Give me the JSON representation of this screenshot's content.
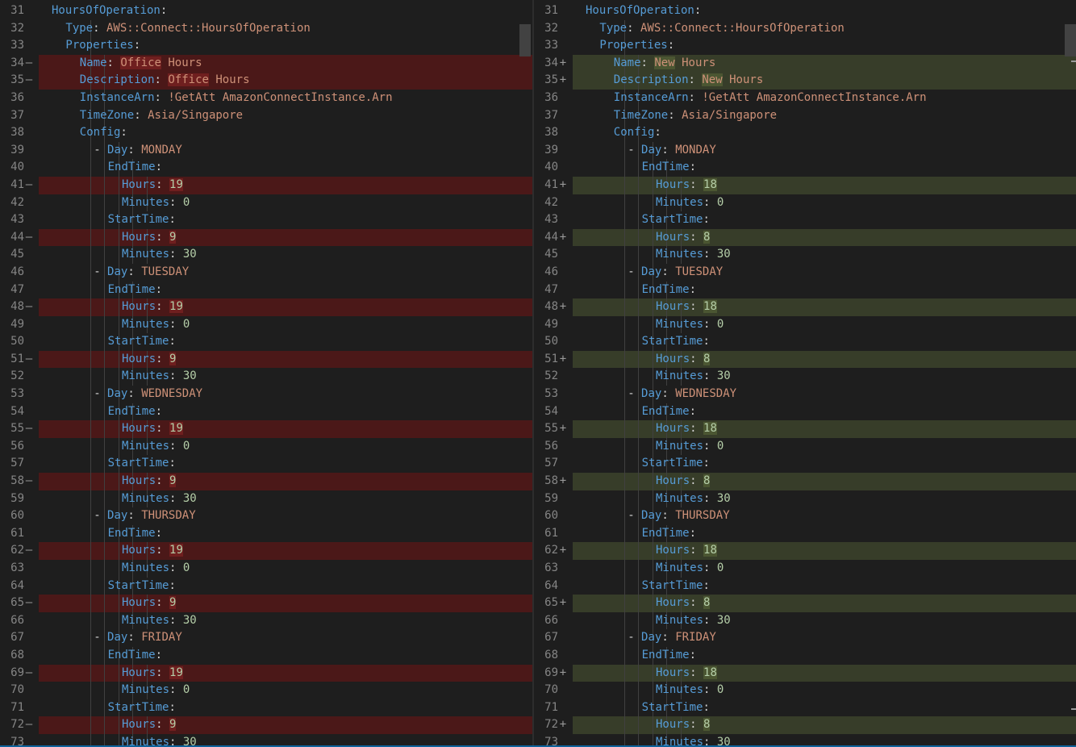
{
  "colors": {
    "background": "#1e1e1e",
    "key": "#569cd6",
    "string": "#ce9178",
    "number": "#b5cea8",
    "removed_line": "#4b1818",
    "added_line": "#373d29",
    "line_number": "#858585"
  },
  "left": {
    "lines": [
      {
        "num": "31",
        "mark": "",
        "type": "ctx",
        "indent": 0,
        "key": "HoursOfOperation",
        "value": "",
        "vtype": ""
      },
      {
        "num": "32",
        "mark": "",
        "type": "ctx",
        "indent": 1,
        "key": "Type",
        "value": "AWS::Connect::HoursOfOperation",
        "vtype": "s"
      },
      {
        "num": "33",
        "mark": "",
        "type": "ctx",
        "indent": 1,
        "key": "Properties",
        "value": "",
        "vtype": ""
      },
      {
        "num": "34",
        "mark": "—",
        "type": "del",
        "indent": 2,
        "key": "Name",
        "word": "Office",
        "value": " Hours",
        "vtype": "s"
      },
      {
        "num": "35",
        "mark": "—",
        "type": "del",
        "indent": 2,
        "key": "Description",
        "word": "Office",
        "value": " Hours",
        "vtype": "s"
      },
      {
        "num": "36",
        "mark": "",
        "type": "ctx",
        "indent": 2,
        "key": "InstanceArn",
        "value": "!GetAtt AmazonConnectInstance.Arn",
        "vtype": "s"
      },
      {
        "num": "37",
        "mark": "",
        "type": "ctx",
        "indent": 2,
        "key": "TimeZone",
        "value": "Asia/Singapore",
        "vtype": "s"
      },
      {
        "num": "38",
        "mark": "",
        "type": "ctx",
        "indent": 2,
        "key": "Config",
        "value": "",
        "vtype": ""
      },
      {
        "num": "39",
        "mark": "",
        "type": "ctx",
        "indent": 3,
        "bullet": "- ",
        "key": "Day",
        "value": "MONDAY",
        "vtype": "s"
      },
      {
        "num": "40",
        "mark": "",
        "type": "ctx",
        "indent": 4,
        "key": "EndTime",
        "value": "",
        "vtype": ""
      },
      {
        "num": "41",
        "mark": "—",
        "type": "del",
        "indent": 5,
        "key": "Hours",
        "word": "19",
        "value": "",
        "vtype": "n"
      },
      {
        "num": "42",
        "mark": "",
        "type": "ctx",
        "indent": 5,
        "key": "Minutes",
        "value": "0",
        "vtype": "n"
      },
      {
        "num": "43",
        "mark": "",
        "type": "ctx",
        "indent": 4,
        "key": "StartTime",
        "value": "",
        "vtype": ""
      },
      {
        "num": "44",
        "mark": "—",
        "type": "del",
        "indent": 5,
        "key": "Hours",
        "word": "9",
        "value": "",
        "vtype": "n"
      },
      {
        "num": "45",
        "mark": "",
        "type": "ctx",
        "indent": 5,
        "key": "Minutes",
        "value": "30",
        "vtype": "n"
      },
      {
        "num": "46",
        "mark": "",
        "type": "ctx",
        "indent": 3,
        "bullet": "- ",
        "key": "Day",
        "value": "TUESDAY",
        "vtype": "s"
      },
      {
        "num": "47",
        "mark": "",
        "type": "ctx",
        "indent": 4,
        "key": "EndTime",
        "value": "",
        "vtype": ""
      },
      {
        "num": "48",
        "mark": "—",
        "type": "del",
        "indent": 5,
        "key": "Hours",
        "word": "19",
        "value": "",
        "vtype": "n"
      },
      {
        "num": "49",
        "mark": "",
        "type": "ctx",
        "indent": 5,
        "key": "Minutes",
        "value": "0",
        "vtype": "n"
      },
      {
        "num": "50",
        "mark": "",
        "type": "ctx",
        "indent": 4,
        "key": "StartTime",
        "value": "",
        "vtype": ""
      },
      {
        "num": "51",
        "mark": "—",
        "type": "del",
        "indent": 5,
        "key": "Hours",
        "word": "9",
        "value": "",
        "vtype": "n"
      },
      {
        "num": "52",
        "mark": "",
        "type": "ctx",
        "indent": 5,
        "key": "Minutes",
        "value": "30",
        "vtype": "n"
      },
      {
        "num": "53",
        "mark": "",
        "type": "ctx",
        "indent": 3,
        "bullet": "- ",
        "key": "Day",
        "value": "WEDNESDAY",
        "vtype": "s"
      },
      {
        "num": "54",
        "mark": "",
        "type": "ctx",
        "indent": 4,
        "key": "EndTime",
        "value": "",
        "vtype": ""
      },
      {
        "num": "55",
        "mark": "—",
        "type": "del",
        "indent": 5,
        "key": "Hours",
        "word": "19",
        "value": "",
        "vtype": "n"
      },
      {
        "num": "56",
        "mark": "",
        "type": "ctx",
        "indent": 5,
        "key": "Minutes",
        "value": "0",
        "vtype": "n"
      },
      {
        "num": "57",
        "mark": "",
        "type": "ctx",
        "indent": 4,
        "key": "StartTime",
        "value": "",
        "vtype": ""
      },
      {
        "num": "58",
        "mark": "—",
        "type": "del",
        "indent": 5,
        "key": "Hours",
        "word": "9",
        "value": "",
        "vtype": "n"
      },
      {
        "num": "59",
        "mark": "",
        "type": "ctx",
        "indent": 5,
        "key": "Minutes",
        "value": "30",
        "vtype": "n"
      },
      {
        "num": "60",
        "mark": "",
        "type": "ctx",
        "indent": 3,
        "bullet": "- ",
        "key": "Day",
        "value": "THURSDAY",
        "vtype": "s"
      },
      {
        "num": "61",
        "mark": "",
        "type": "ctx",
        "indent": 4,
        "key": "EndTime",
        "value": "",
        "vtype": ""
      },
      {
        "num": "62",
        "mark": "—",
        "type": "del",
        "indent": 5,
        "key": "Hours",
        "word": "19",
        "value": "",
        "vtype": "n"
      },
      {
        "num": "63",
        "mark": "",
        "type": "ctx",
        "indent": 5,
        "key": "Minutes",
        "value": "0",
        "vtype": "n"
      },
      {
        "num": "64",
        "mark": "",
        "type": "ctx",
        "indent": 4,
        "key": "StartTime",
        "value": "",
        "vtype": ""
      },
      {
        "num": "65",
        "mark": "—",
        "type": "del",
        "indent": 5,
        "key": "Hours",
        "word": "9",
        "value": "",
        "vtype": "n"
      },
      {
        "num": "66",
        "mark": "",
        "type": "ctx",
        "indent": 5,
        "key": "Minutes",
        "value": "30",
        "vtype": "n"
      },
      {
        "num": "67",
        "mark": "",
        "type": "ctx",
        "indent": 3,
        "bullet": "- ",
        "key": "Day",
        "value": "FRIDAY",
        "vtype": "s"
      },
      {
        "num": "68",
        "mark": "",
        "type": "ctx",
        "indent": 4,
        "key": "EndTime",
        "value": "",
        "vtype": ""
      },
      {
        "num": "69",
        "mark": "—",
        "type": "del",
        "indent": 5,
        "key": "Hours",
        "word": "19",
        "value": "",
        "vtype": "n"
      },
      {
        "num": "70",
        "mark": "",
        "type": "ctx",
        "indent": 5,
        "key": "Minutes",
        "value": "0",
        "vtype": "n"
      },
      {
        "num": "71",
        "mark": "",
        "type": "ctx",
        "indent": 4,
        "key": "StartTime",
        "value": "",
        "vtype": ""
      },
      {
        "num": "72",
        "mark": "—",
        "type": "del",
        "indent": 5,
        "key": "Hours",
        "word": "9",
        "value": "",
        "vtype": "n"
      },
      {
        "num": "73",
        "mark": "",
        "type": "ctx",
        "indent": 5,
        "key": "Minutes",
        "value": "30",
        "vtype": "n"
      }
    ]
  },
  "right": {
    "lines": [
      {
        "num": "31",
        "mark": "",
        "type": "ctx",
        "indent": 0,
        "key": "HoursOfOperation",
        "value": "",
        "vtype": ""
      },
      {
        "num": "32",
        "mark": "",
        "type": "ctx",
        "indent": 1,
        "key": "Type",
        "value": "AWS::Connect::HoursOfOperation",
        "vtype": "s"
      },
      {
        "num": "33",
        "mark": "",
        "type": "ctx",
        "indent": 1,
        "key": "Properties",
        "value": "",
        "vtype": ""
      },
      {
        "num": "34",
        "mark": "+",
        "type": "ins",
        "indent": 2,
        "key": "Name",
        "word": "New",
        "value": " Hours",
        "vtype": "s"
      },
      {
        "num": "35",
        "mark": "+",
        "type": "ins",
        "indent": 2,
        "key": "Description",
        "word": "New",
        "value": " Hours",
        "vtype": "s"
      },
      {
        "num": "36",
        "mark": "",
        "type": "ctx",
        "indent": 2,
        "key": "InstanceArn",
        "value": "!GetAtt AmazonConnectInstance.Arn",
        "vtype": "s"
      },
      {
        "num": "37",
        "mark": "",
        "type": "ctx",
        "indent": 2,
        "key": "TimeZone",
        "value": "Asia/Singapore",
        "vtype": "s"
      },
      {
        "num": "38",
        "mark": "",
        "type": "ctx",
        "indent": 2,
        "key": "Config",
        "value": "",
        "vtype": ""
      },
      {
        "num": "39",
        "mark": "",
        "type": "ctx",
        "indent": 3,
        "bullet": "- ",
        "key": "Day",
        "value": "MONDAY",
        "vtype": "s"
      },
      {
        "num": "40",
        "mark": "",
        "type": "ctx",
        "indent": 4,
        "key": "EndTime",
        "value": "",
        "vtype": ""
      },
      {
        "num": "41",
        "mark": "+",
        "type": "ins",
        "indent": 5,
        "key": "Hours",
        "word": "18",
        "value": "",
        "vtype": "n"
      },
      {
        "num": "42",
        "mark": "",
        "type": "ctx",
        "indent": 5,
        "key": "Minutes",
        "value": "0",
        "vtype": "n"
      },
      {
        "num": "43",
        "mark": "",
        "type": "ctx",
        "indent": 4,
        "key": "StartTime",
        "value": "",
        "vtype": ""
      },
      {
        "num": "44",
        "mark": "+",
        "type": "ins",
        "indent": 5,
        "key": "Hours",
        "word": "8",
        "value": "",
        "vtype": "n"
      },
      {
        "num": "45",
        "mark": "",
        "type": "ctx",
        "indent": 5,
        "key": "Minutes",
        "value": "30",
        "vtype": "n"
      },
      {
        "num": "46",
        "mark": "",
        "type": "ctx",
        "indent": 3,
        "bullet": "- ",
        "key": "Day",
        "value": "TUESDAY",
        "vtype": "s"
      },
      {
        "num": "47",
        "mark": "",
        "type": "ctx",
        "indent": 4,
        "key": "EndTime",
        "value": "",
        "vtype": ""
      },
      {
        "num": "48",
        "mark": "+",
        "type": "ins",
        "indent": 5,
        "key": "Hours",
        "word": "18",
        "value": "",
        "vtype": "n"
      },
      {
        "num": "49",
        "mark": "",
        "type": "ctx",
        "indent": 5,
        "key": "Minutes",
        "value": "0",
        "vtype": "n"
      },
      {
        "num": "50",
        "mark": "",
        "type": "ctx",
        "indent": 4,
        "key": "StartTime",
        "value": "",
        "vtype": ""
      },
      {
        "num": "51",
        "mark": "+",
        "type": "ins",
        "indent": 5,
        "key": "Hours",
        "word": "8",
        "value": "",
        "vtype": "n"
      },
      {
        "num": "52",
        "mark": "",
        "type": "ctx",
        "indent": 5,
        "key": "Minutes",
        "value": "30",
        "vtype": "n"
      },
      {
        "num": "53",
        "mark": "",
        "type": "ctx",
        "indent": 3,
        "bullet": "- ",
        "key": "Day",
        "value": "WEDNESDAY",
        "vtype": "s"
      },
      {
        "num": "54",
        "mark": "",
        "type": "ctx",
        "indent": 4,
        "key": "EndTime",
        "value": "",
        "vtype": ""
      },
      {
        "num": "55",
        "mark": "+",
        "type": "ins",
        "indent": 5,
        "key": "Hours",
        "word": "18",
        "value": "",
        "vtype": "n"
      },
      {
        "num": "56",
        "mark": "",
        "type": "ctx",
        "indent": 5,
        "key": "Minutes",
        "value": "0",
        "vtype": "n"
      },
      {
        "num": "57",
        "mark": "",
        "type": "ctx",
        "indent": 4,
        "key": "StartTime",
        "value": "",
        "vtype": ""
      },
      {
        "num": "58",
        "mark": "+",
        "type": "ins",
        "indent": 5,
        "key": "Hours",
        "word": "8",
        "value": "",
        "vtype": "n"
      },
      {
        "num": "59",
        "mark": "",
        "type": "ctx",
        "indent": 5,
        "key": "Minutes",
        "value": "30",
        "vtype": "n"
      },
      {
        "num": "60",
        "mark": "",
        "type": "ctx",
        "indent": 3,
        "bullet": "- ",
        "key": "Day",
        "value": "THURSDAY",
        "vtype": "s"
      },
      {
        "num": "61",
        "mark": "",
        "type": "ctx",
        "indent": 4,
        "key": "EndTime",
        "value": "",
        "vtype": ""
      },
      {
        "num": "62",
        "mark": "+",
        "type": "ins",
        "indent": 5,
        "key": "Hours",
        "word": "18",
        "value": "",
        "vtype": "n"
      },
      {
        "num": "63",
        "mark": "",
        "type": "ctx",
        "indent": 5,
        "key": "Minutes",
        "value": "0",
        "vtype": "n"
      },
      {
        "num": "64",
        "mark": "",
        "type": "ctx",
        "indent": 4,
        "key": "StartTime",
        "value": "",
        "vtype": ""
      },
      {
        "num": "65",
        "mark": "+",
        "type": "ins",
        "indent": 5,
        "key": "Hours",
        "word": "8",
        "value": "",
        "vtype": "n"
      },
      {
        "num": "66",
        "mark": "",
        "type": "ctx",
        "indent": 5,
        "key": "Minutes",
        "value": "30",
        "vtype": "n"
      },
      {
        "num": "67",
        "mark": "",
        "type": "ctx",
        "indent": 3,
        "bullet": "- ",
        "key": "Day",
        "value": "FRIDAY",
        "vtype": "s"
      },
      {
        "num": "68",
        "mark": "",
        "type": "ctx",
        "indent": 4,
        "key": "EndTime",
        "value": "",
        "vtype": ""
      },
      {
        "num": "69",
        "mark": "+",
        "type": "ins",
        "indent": 5,
        "key": "Hours",
        "word": "18",
        "value": "",
        "vtype": "n"
      },
      {
        "num": "70",
        "mark": "",
        "type": "ctx",
        "indent": 5,
        "key": "Minutes",
        "value": "0",
        "vtype": "n"
      },
      {
        "num": "71",
        "mark": "",
        "type": "ctx",
        "indent": 4,
        "key": "StartTime",
        "value": "",
        "vtype": ""
      },
      {
        "num": "72",
        "mark": "+",
        "type": "ins",
        "indent": 5,
        "key": "Hours",
        "word": "8",
        "value": "",
        "vtype": "n"
      },
      {
        "num": "73",
        "mark": "",
        "type": "ctx",
        "indent": 5,
        "key": "Minutes",
        "value": "30",
        "vtype": "n"
      }
    ]
  }
}
